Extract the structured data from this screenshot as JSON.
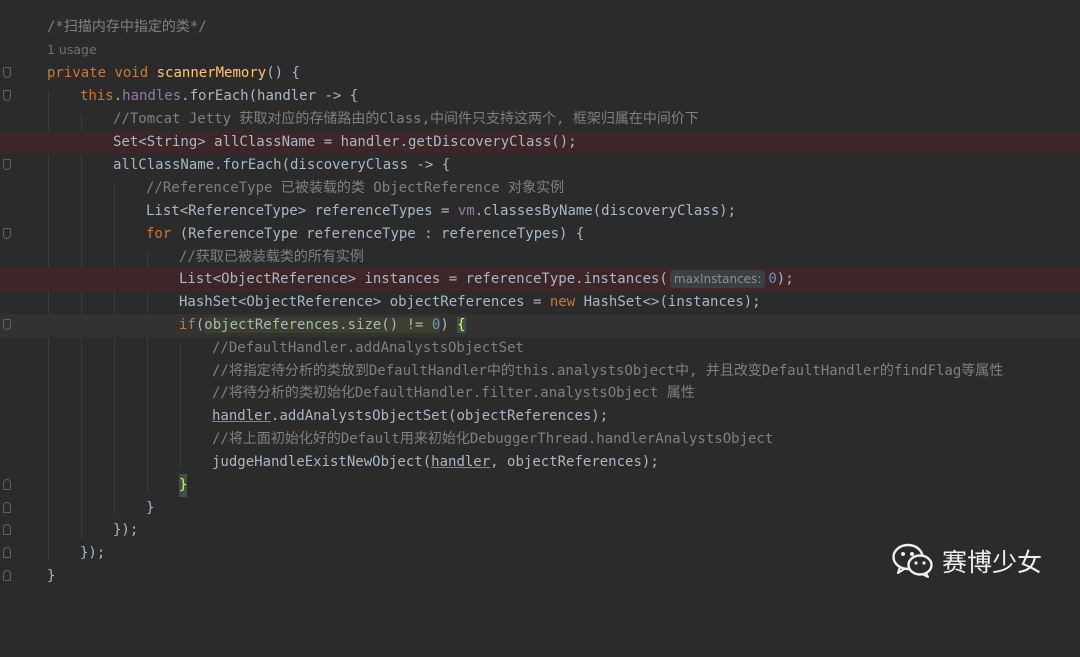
{
  "comment_title": "/*扫描内存中指定的类*/",
  "usage": "1 usage",
  "method": {
    "kw_private": "private",
    "kw_void": "void",
    "name": "scannerMemory",
    "sig_tail": "() {"
  },
  "line3": {
    "this": "this",
    "dot": ".",
    "field": "handles",
    "call": ".forEach(handler -> {"
  },
  "line4_comment": "//Tomcat Jetty 获取对应的存储路由的Class,中间件只支持这两个, 框架归属在中间价下",
  "line5": "Set<String> allClassName = handler.getDiscoveryClass();",
  "line6": "allClassName.forEach(discoveryClass -> {",
  "line7_comment": "//ReferenceType 已被装载的类 ObjectReference 对象实例",
  "line8": {
    "pre": "List<ReferenceType> referenceTypes = ",
    "vm": "vm",
    "post": ".classesByName(discoveryClass);"
  },
  "line9": {
    "kw": "for",
    "rest": " (ReferenceType referenceType : referenceTypes) {"
  },
  "line10_comment": "//获取已被装载类的所有实例",
  "line11": {
    "pre": "List<ObjectReference> instances = referenceType.instances(",
    "hint": "maxInstances:",
    "num": "0",
    "post": ");"
  },
  "line12": {
    "pre": "HashSet<ObjectReference> objectReferences = ",
    "kw": "new",
    "post": " HashSet<>(instances);"
  },
  "line13": {
    "kw": "if",
    "paren": "(",
    "cond": "objectReferences.size() != ",
    "num": "0",
    "close": ") ",
    "brace": "{"
  },
  "line14_comment": "//DefaultHandler.addAnalystsObjectSet",
  "line15_comment": "//将指定待分析的类放到DefaultHandler中的this.analystsObject中, 并且改变DefaultHandler的findFlag等属性",
  "line16_comment": "//将待分析的类初始化DefaultHandler.filter.analystsObject 属性",
  "line17": {
    "var": "handler",
    "rest": ".addAnalystsObjectSet(objectReferences);"
  },
  "line18_comment": "//将上面初始化好的Default用来初始化DebuggerThread.handlerAnalystsObject",
  "line19": {
    "pre": "judgeHandleExistNewObject(",
    "var": "handler",
    "post": ", objectReferences);"
  },
  "line20_brace": "}",
  "line21_brace": "}",
  "line22": "});",
  "line23": "});",
  "line24_brace": "}",
  "watermark": {
    "text": "赛博少女",
    "icon": "wechat-icon"
  },
  "colors": {
    "background": "#2b2b2b",
    "keyword": "#cc7832",
    "function": "#ffc66d",
    "field": "#9876aa",
    "number": "#6897bb",
    "comment": "#808080",
    "error_line": "#3d2627"
  }
}
